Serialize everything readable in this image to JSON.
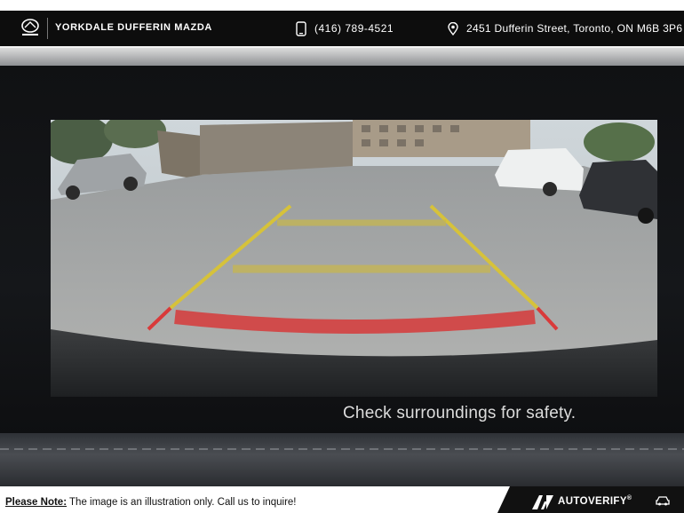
{
  "header": {
    "dealer_name": "YORKDALE DUFFERIN MAZDA",
    "phone": "(416) 789-4521",
    "address": "2451 Dufferin Street, Toronto, ON M6B 3P6"
  },
  "screen": {
    "message": "Check surroundings for safety."
  },
  "footer": {
    "note_label": "Please Note:",
    "note_text": " The image is an illustration only. Call us to inquire!",
    "brand": "AUTOVERIFY",
    "brand_mark": "®"
  },
  "icons": {
    "logo": "mazda-logo-icon",
    "phone": "phone-icon",
    "location": "location-pin-icon",
    "car": "car-icon"
  },
  "colors": {
    "guide_yellow": "#d6c23a",
    "guide_red": "#d93a3a",
    "header_bg": "#0d0d0d"
  }
}
